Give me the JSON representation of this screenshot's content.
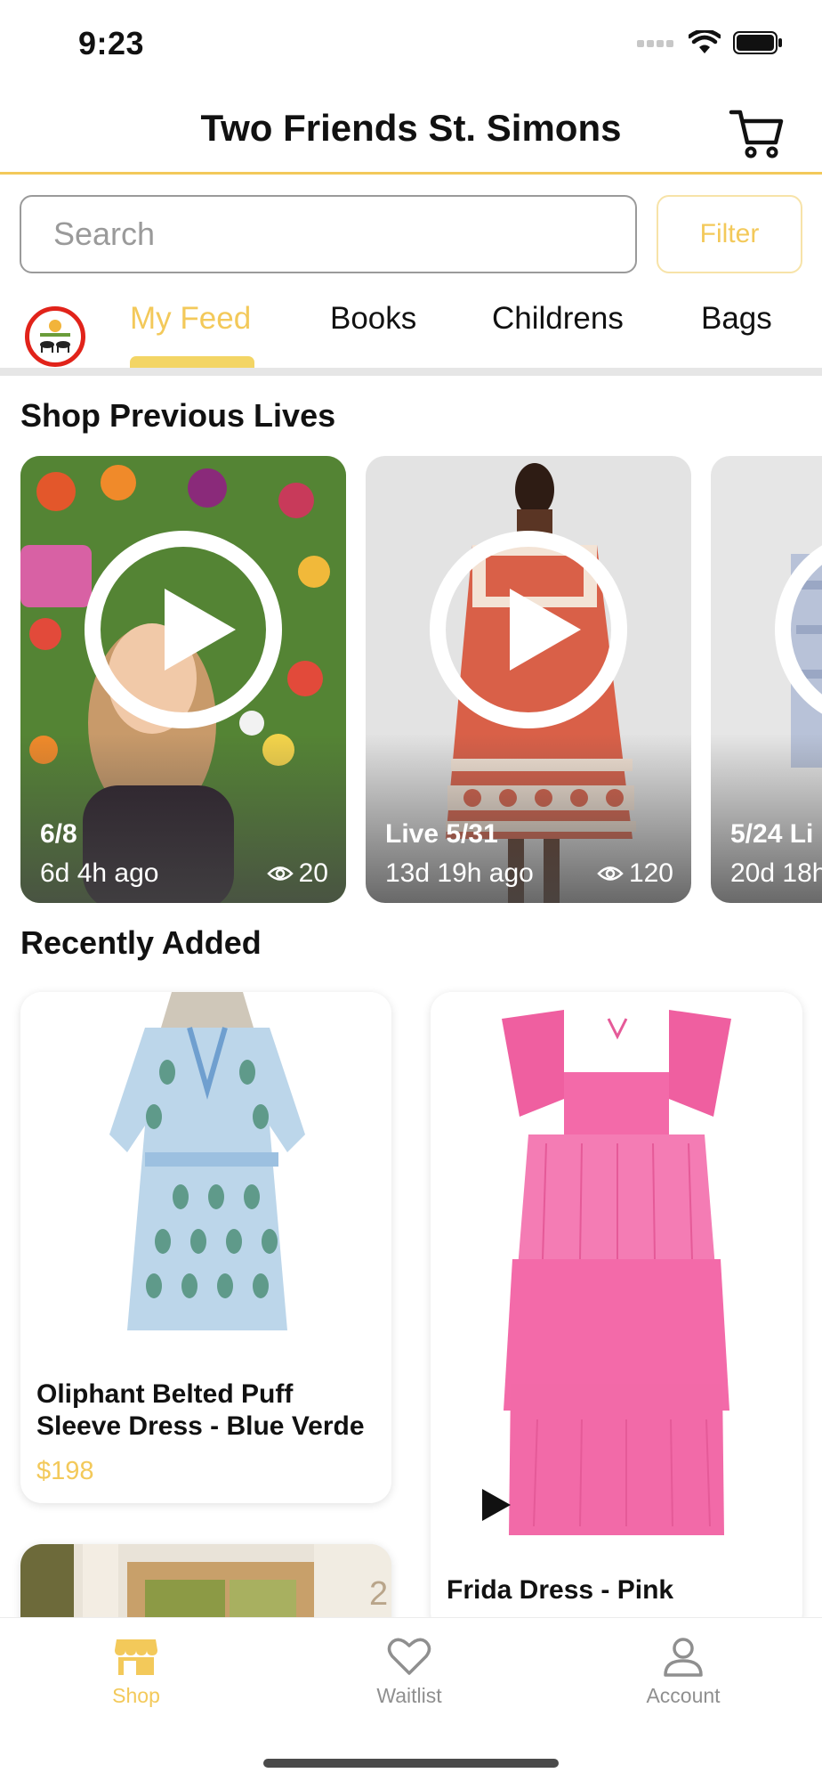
{
  "status_bar": {
    "time": "9:23"
  },
  "header": {
    "title": "Two Friends St. Simons"
  },
  "search": {
    "placeholder": "Search",
    "filter_label": "Filter"
  },
  "tabs": [
    "My Feed",
    "Books",
    "Childrens",
    "Bags"
  ],
  "sections": {
    "previous_lives": "Shop Previous Lives",
    "recently_added": "Recently Added"
  },
  "lives": [
    {
      "title": "6/8",
      "ago": "6d 4h ago",
      "views": "20"
    },
    {
      "title": "Live 5/31",
      "ago": "13d 19h ago",
      "views": "120"
    },
    {
      "title": "5/24 Li",
      "ago": "20d 18h",
      "views": ""
    }
  ],
  "products": [
    {
      "name_line1": "Oliphant Belted Puff",
      "name_line2": "Sleeve Dress - Blue Verde",
      "price": "$198"
    },
    {
      "name_line1": "Frida Dress - Pink",
      "price": ""
    }
  ],
  "tabbar": {
    "shop": "Shop",
    "waitlist": "Waitlist",
    "account": "Account"
  },
  "colors": {
    "accent": "#f3c95a",
    "divider": "#e6e6e6",
    "live_red": "#e1231a"
  },
  "icons": [
    "cart-icon",
    "play-icon",
    "eye-icon",
    "store-icon",
    "heart-icon",
    "person-icon"
  ]
}
